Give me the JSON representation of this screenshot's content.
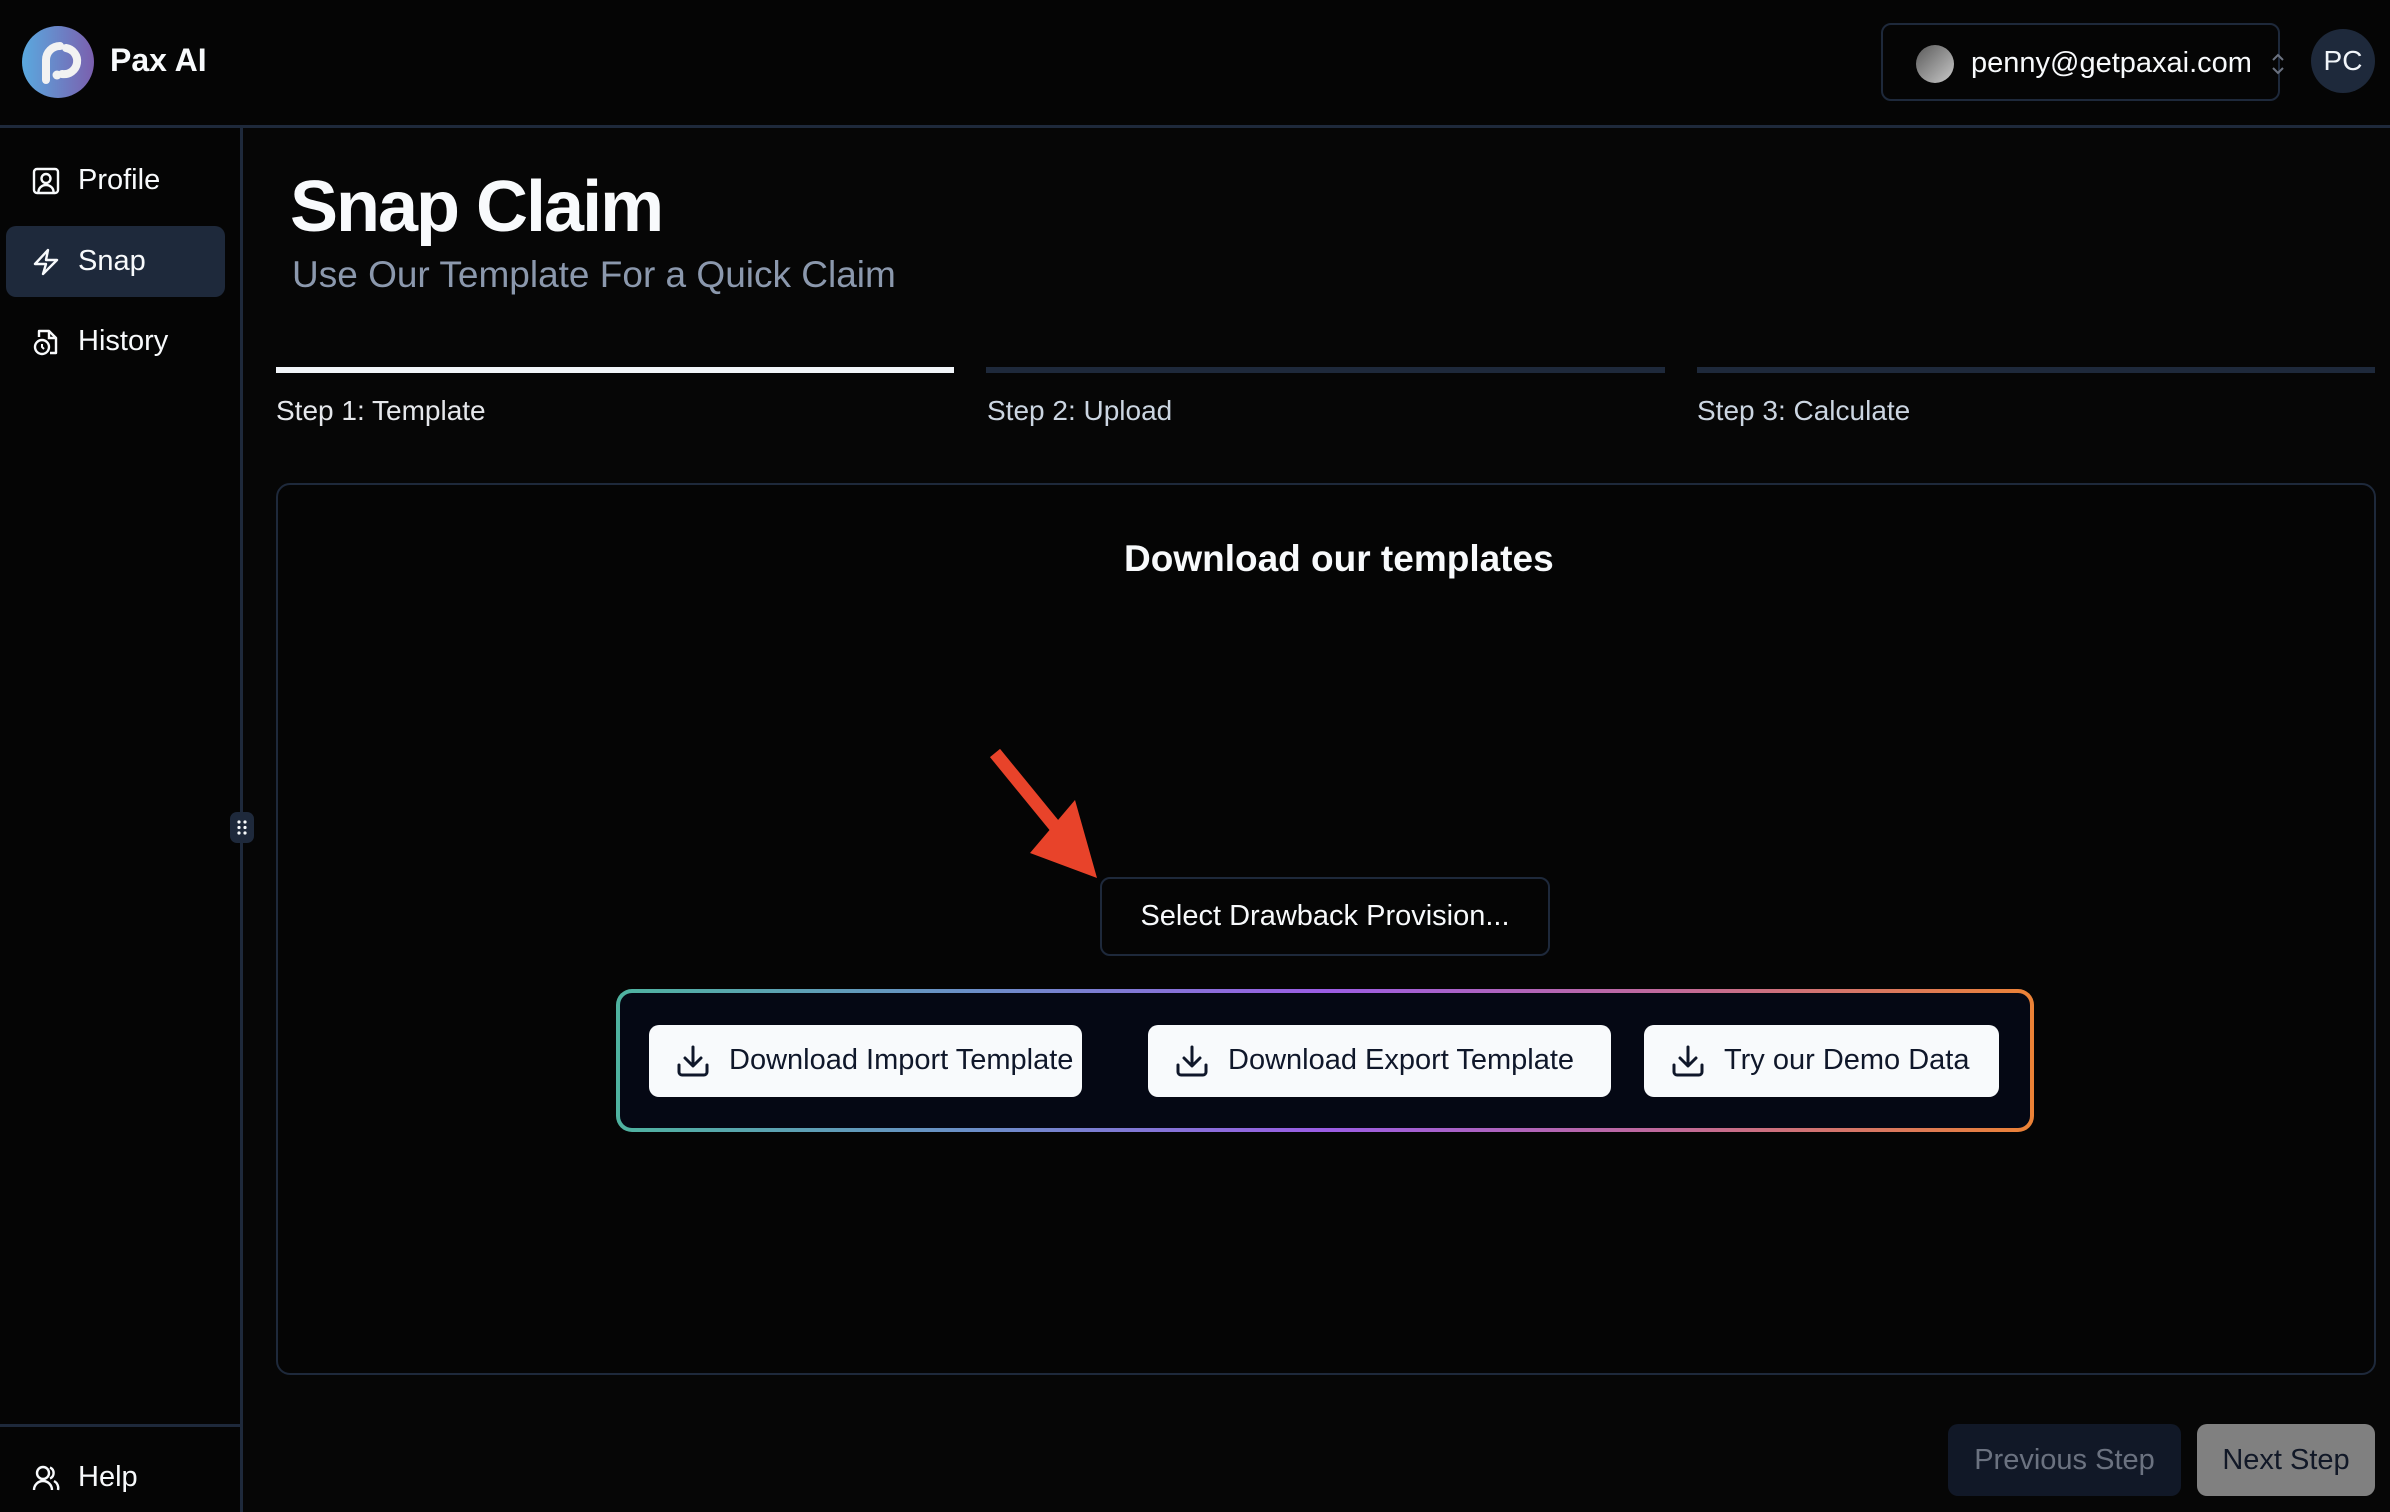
{
  "app": {
    "brand": "Pax AI"
  },
  "account": {
    "email": "penny@getpaxai.com",
    "avatar_initials": "PC"
  },
  "sidebar": {
    "items": [
      {
        "label": "Profile",
        "icon": "user-square-icon",
        "active": false
      },
      {
        "label": "Snap",
        "icon": "lightning-icon",
        "active": true
      },
      {
        "label": "History",
        "icon": "file-clock-icon",
        "active": false
      }
    ],
    "footer": {
      "label": "Help",
      "icon": "users-icon"
    }
  },
  "page": {
    "title": "Snap Claim",
    "subtitle": "Use Our Template For a Quick Claim"
  },
  "steps": [
    {
      "label": "Step 1: Template",
      "active": true
    },
    {
      "label": "Step 2: Upload",
      "active": false
    },
    {
      "label": "Step 3: Calculate",
      "active": false
    }
  ],
  "card": {
    "title": "Download our templates",
    "select": {
      "placeholder": "Select Drawback Provision..."
    },
    "buttons": [
      {
        "label": "Download Import Template",
        "icon": "download-icon"
      },
      {
        "label": "Download Export Template",
        "icon": "download-icon"
      },
      {
        "label": "Try our Demo Data",
        "icon": "download-icon"
      }
    ]
  },
  "footer_nav": {
    "previous": "Previous Step",
    "next": "Next Step"
  },
  "colors": {
    "accent_active_bg": "#1e293b",
    "annotation_arrow": "#e8432a",
    "gradient_start": "#4fb3a0",
    "gradient_mid": "#9b5de5",
    "gradient_end": "#ec8236"
  }
}
